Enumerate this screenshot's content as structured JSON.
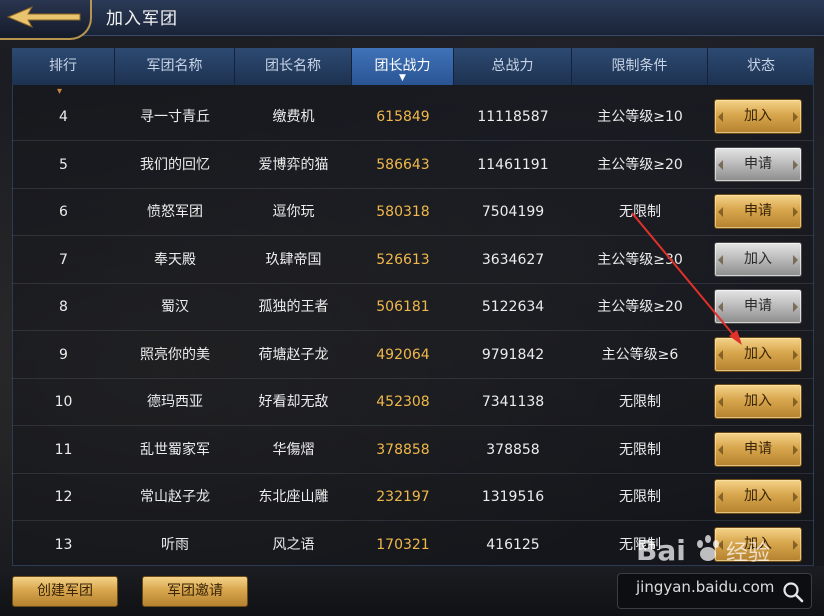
{
  "window": {
    "title": "加入军团"
  },
  "table": {
    "headers": [
      "排行",
      "军团名称",
      "团长名称",
      "团长战力",
      "总战力",
      "限制条件",
      "状态"
    ],
    "active_sort_column": 3,
    "rows": [
      {
        "rank": "4",
        "legion": "寻一寸青丘",
        "leader": "缴费机",
        "leader_power": "615849",
        "total_power": "11118587",
        "restriction": "主公等级≥10",
        "status": "加入",
        "status_style": "gold"
      },
      {
        "rank": "5",
        "legion": "我们的回忆",
        "leader": "爱博弈的猫",
        "leader_power": "586643",
        "total_power": "11461191",
        "restriction": "主公等级≥20",
        "status": "申请",
        "status_style": "silver"
      },
      {
        "rank": "6",
        "legion": "愤怒军团",
        "leader": "逗你玩",
        "leader_power": "580318",
        "total_power": "7504199",
        "restriction": "无限制",
        "status": "申请",
        "status_style": "gold"
      },
      {
        "rank": "7",
        "legion": "奉天殿",
        "leader": "玖肆帝国",
        "leader_power": "526613",
        "total_power": "3634627",
        "restriction": "主公等级≥30",
        "status": "加入",
        "status_style": "silver"
      },
      {
        "rank": "8",
        "legion": "蜀汉",
        "leader": "孤独的王者",
        "leader_power": "506181",
        "total_power": "5122634",
        "restriction": "主公等级≥20",
        "status": "申请",
        "status_style": "silver"
      },
      {
        "rank": "9",
        "legion": "照亮你的美",
        "leader": "荷塘赵子龙",
        "leader_power": "492064",
        "total_power": "9791842",
        "restriction": "主公等级≥6",
        "status": "加入",
        "status_style": "gold"
      },
      {
        "rank": "10",
        "legion": "德玛西亚",
        "leader": "好看却无敌",
        "leader_power": "452308",
        "total_power": "7341138",
        "restriction": "无限制",
        "status": "加入",
        "status_style": "gold"
      },
      {
        "rank": "11",
        "legion": "乱世蜀家军",
        "leader": "华傷熠",
        "leader_power": "378858",
        "total_power": "378858",
        "restriction": "无限制",
        "status": "申请",
        "status_style": "gold"
      },
      {
        "rank": "12",
        "legion": "常山赵子龙",
        "leader": "东北座山雕",
        "leader_power": "232197",
        "total_power": "1319516",
        "restriction": "无限制",
        "status": "加入",
        "status_style": "gold"
      },
      {
        "rank": "13",
        "legion": "听雨",
        "leader": "风之语",
        "leader_power": "170321",
        "total_power": "416125",
        "restriction": "无限制",
        "status": "加入",
        "status_style": "gold"
      }
    ]
  },
  "bottom": {
    "create_label": "创建军团",
    "invite_label": "军团邀请",
    "search_value": "",
    "search_placeholder": ""
  },
  "watermark": {
    "brand": "Baidu经验",
    "url": "jingyan.baidu.com"
  },
  "icons": {
    "back": "back-arrow-icon",
    "search": "search-icon",
    "sort": "sort-down-icon"
  },
  "colors": {
    "power_text": "#f0b84a",
    "gold_button": "#d8a64d",
    "silver_button": "#b9b9b9",
    "header_active": "#3f72b8",
    "annotation_arrow": "#e0312b"
  }
}
